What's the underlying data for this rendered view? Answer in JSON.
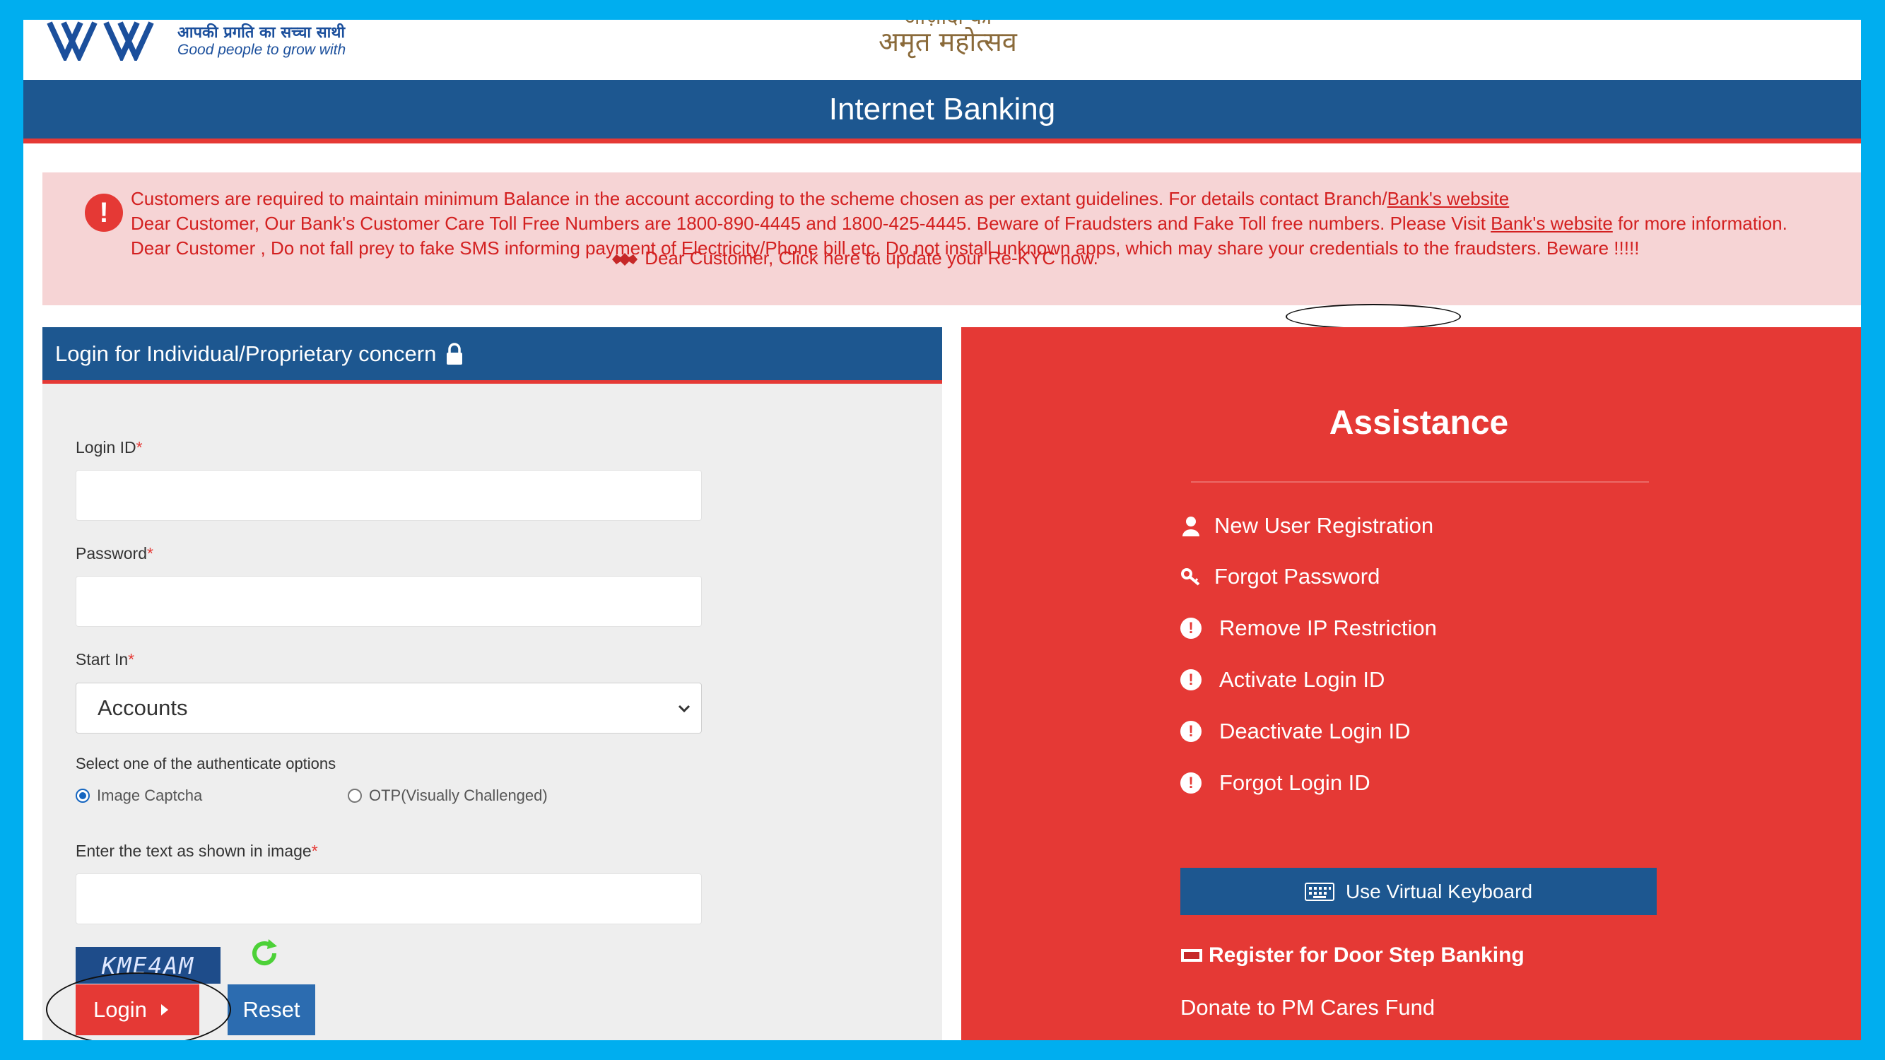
{
  "header": {
    "tagline_hindi": "आपकी प्रगति का सच्चा साथी",
    "tagline_english": "Good people to grow with",
    "amrit_top": "आज़ादी का",
    "amrit_bottom": "अमृत महोत्सव",
    "page_title": "Internet Banking"
  },
  "notice": {
    "line1_text": "Customers are required to maintain minimum Balance in the account according to the scheme chosen as per extant guidelines. For details contact Branch/",
    "line1_link": "Bank's website",
    "line2_text": "Dear Customer, Our Bank's Customer Care Toll Free Numbers are 1800-890-4445 and 1800-425-4445. Beware of Fraudsters and Fake Toll free numbers. Please Visit ",
    "line2_link": "Bank's website",
    "line2_suffix": " for more information.",
    "line3_text": "Dear Customer , Do not fall prey to fake SMS informing payment of Electricity/Phone bill etc. Do not install unknown apps, which may share your credentials to the fraudsters. Beware !!!!!",
    "kyc_text": "Dear Customer, Click here to update your Re-KYC now."
  },
  "login": {
    "header_title": "Login for Individual/Proprietary concern",
    "login_id_label": "Login ID",
    "password_label": "Password",
    "start_in_label": "Start In",
    "start_in_value": "Accounts",
    "auth_label": "Select one of the authenticate options",
    "radio_captcha": "Image Captcha",
    "radio_otp": "OTP(Visually Challenged)",
    "captcha_label": "Enter the text as shown in image",
    "captcha_text": "KME4AM",
    "required_mark": "*",
    "login_button": "Login",
    "reset_button": "Reset"
  },
  "assistance": {
    "title": "Assistance",
    "items": [
      {
        "label": "New User Registration",
        "icon": "user-icon"
      },
      {
        "label": "Forgot Password",
        "icon": "key-icon"
      },
      {
        "label": "Remove IP Restriction",
        "icon": "exclamation-icon"
      },
      {
        "label": "Activate Login ID",
        "icon": "exclamation-icon"
      },
      {
        "label": "Deactivate Login ID",
        "icon": "exclamation-icon"
      },
      {
        "label": "Forgot Login ID",
        "icon": "exclamation-icon"
      }
    ],
    "virtual_keyboard": "Use Virtual Keyboard",
    "door_step": "Register for Door Step Banking",
    "pm_cares": "Donate to PM Cares Fund"
  },
  "colors": {
    "frame": "#00AEEF",
    "primary_blue": "#1D5790",
    "accent_red": "#E53935",
    "notice_bg": "#F6D4D5"
  }
}
